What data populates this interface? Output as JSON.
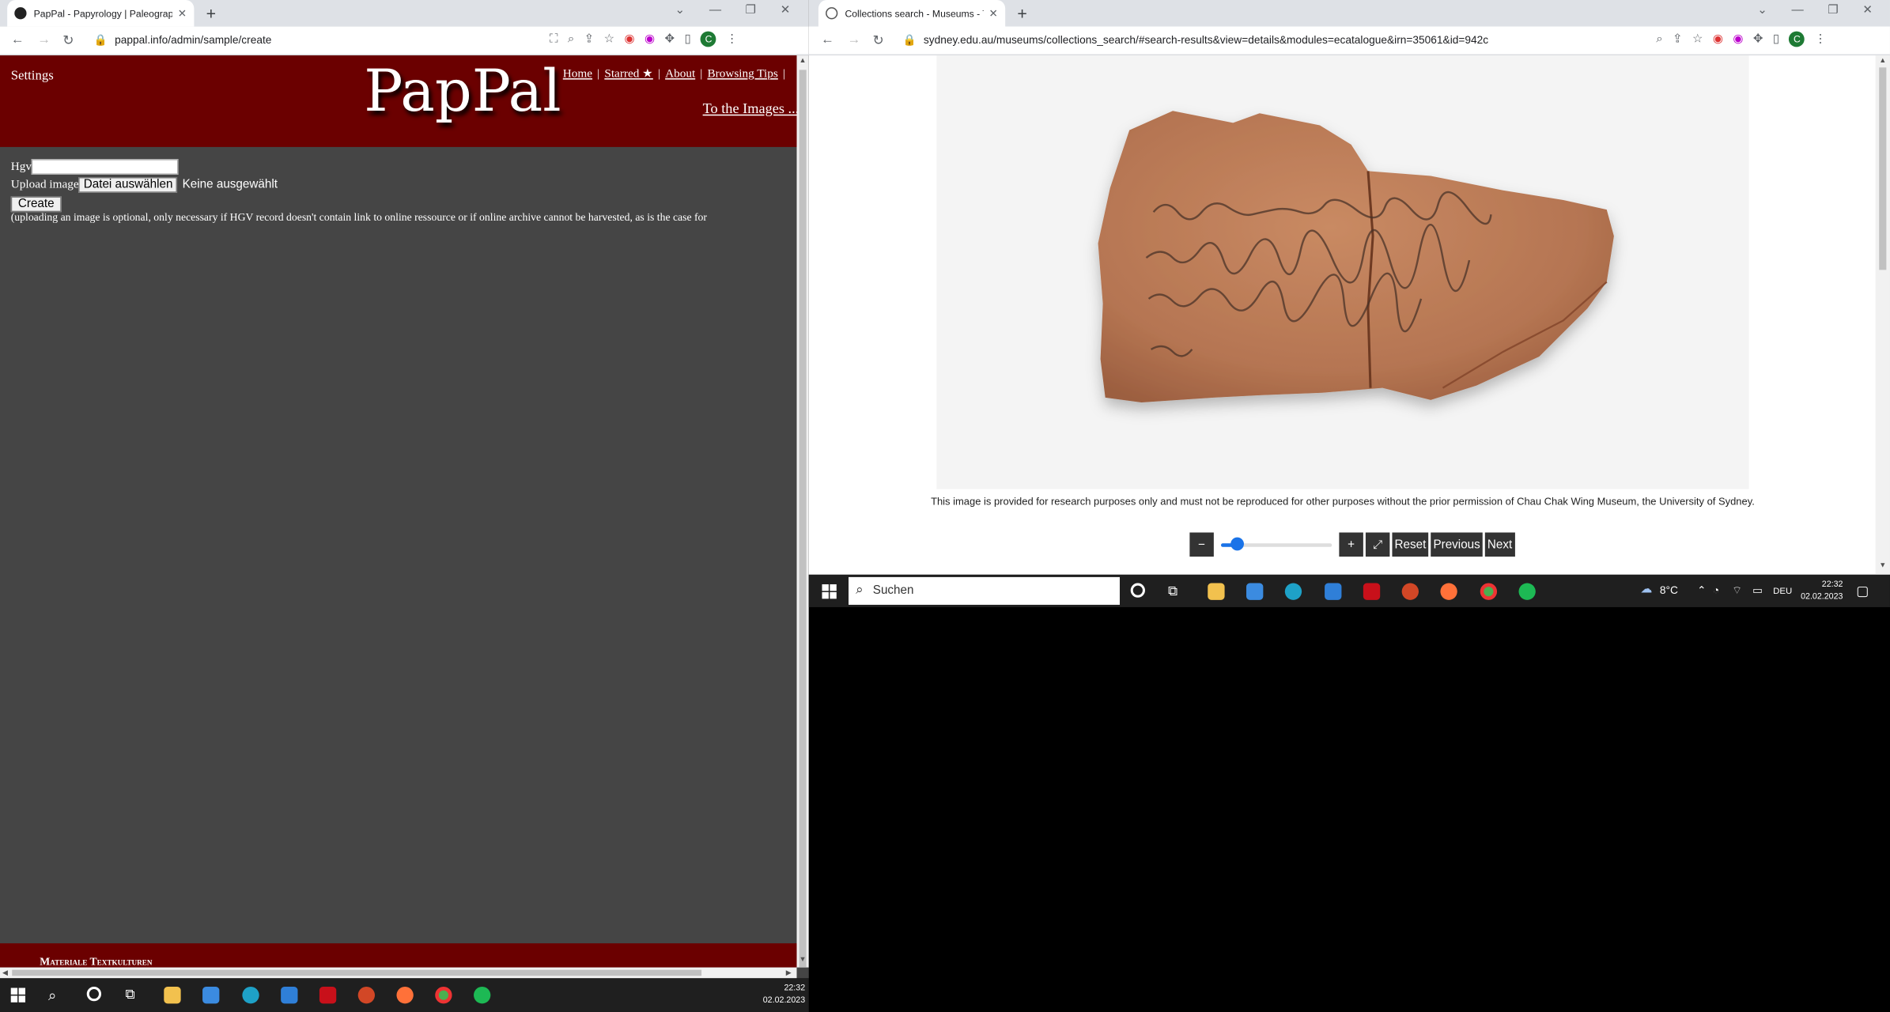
{
  "left_window": {
    "tab_title": "PapPal - Papyrology | Paleograph",
    "url": "pappal.info/admin/sample/create",
    "header": {
      "settings": "Settings",
      "logo": "PapPal",
      "nav": [
        "Home",
        "Starred ★",
        "About",
        "Browsing Tips"
      ],
      "to_images": "To the Images ..."
    },
    "form": {
      "hgv_label": "Hgv",
      "hgv_value": "",
      "upload_label": "Upload image",
      "file_button": "Datei auswählen",
      "no_file": "Keine ausgewählt",
      "create_button": "Create",
      "note": "(uploading an image is optional, only necessary if HGV record doesn't contain link to online ressource or if online archive cannot be harvested, as is the case for"
    },
    "footer": "Materiale Textkulturen",
    "clock": {
      "time": "22:32",
      "date": "02.02.2023"
    }
  },
  "right_window": {
    "tab_title": "Collections search - Museums - T",
    "url": "sydney.edu.au/museums/collections_search/#search-results&view=details&modules=ecatalogue&irn=35061&id=942c",
    "caption": "This image is provided for research purposes only and must not be reproduced for other purposes without the prior permission of Chau Chak Wing Museum, the University of Sydney.",
    "controls": {
      "zoom_out": "−",
      "zoom_in": "+",
      "fit": "⤢",
      "reset": "Reset",
      "previous": "Previous",
      "next": "Next",
      "zoom_level": 0.1
    },
    "taskbar": {
      "search_placeholder": "Suchen",
      "weather": "8°C",
      "lang": "DEU",
      "time": "22:32",
      "date": "02.02.2023"
    }
  },
  "icons": {
    "taskbar_left": [
      "windows-icon",
      "search-icon",
      "cortana-icon",
      "task-view-icon",
      "explorer-icon",
      "store-icon",
      "edge-icon",
      "mail-icon",
      "acrobat-icon",
      "powerpoint-icon",
      "firefox-icon",
      "chrome-icon",
      "spotify-icon"
    ]
  },
  "colors": {
    "header_red": "#6b0000",
    "page_gray": "#454545",
    "accent_blue": "#1a73e8"
  }
}
